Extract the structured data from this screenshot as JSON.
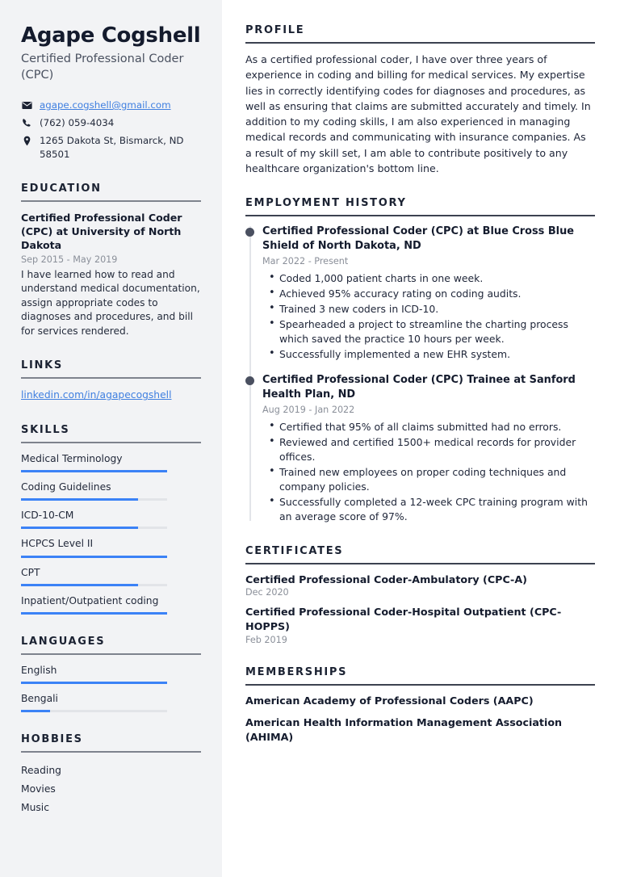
{
  "sidebar": {
    "name": "Agape Cogshell",
    "job_title": "Certified Professional Coder (CPC)",
    "contacts": [
      {
        "icon": "envelope-icon",
        "text": "agape.cogshell@gmail.com",
        "is_link": true
      },
      {
        "icon": "phone-icon",
        "text": "(762) 059-4034",
        "is_link": false
      },
      {
        "icon": "map-pin-icon",
        "text": "1265 Dakota St, Bismarck, ND 58501",
        "is_link": false
      }
    ],
    "education": {
      "heading": "EDUCATION",
      "items": [
        {
          "title": "Certified Professional Coder (CPC) at University of North Dakota",
          "date": "Sep 2015 - May 2019",
          "description": "I have learned how to read and understand medical documentation, assign appropriate codes to diagnoses and procedures, and bill for services rendered."
        }
      ]
    },
    "links": {
      "heading": "LINKS",
      "items": [
        {
          "label": "linkedin.com/in/agapecogshell"
        }
      ]
    },
    "skills": {
      "heading": "SKILLS",
      "items": [
        {
          "label": "Medical Terminology",
          "level": 100
        },
        {
          "label": "Coding Guidelines",
          "level": 80
        },
        {
          "label": "ICD-10-CM",
          "level": 80
        },
        {
          "label": "HCPCS Level II",
          "level": 100
        },
        {
          "label": "CPT",
          "level": 80
        },
        {
          "label": "Inpatient/Outpatient coding",
          "level": 100
        }
      ]
    },
    "languages": {
      "heading": "LANGUAGES",
      "items": [
        {
          "label": "English",
          "level": 100
        },
        {
          "label": "Bengali",
          "level": 20
        }
      ]
    },
    "hobbies": {
      "heading": "HOBBIES",
      "items": [
        {
          "label": "Reading"
        },
        {
          "label": "Movies"
        },
        {
          "label": "Music"
        }
      ]
    }
  },
  "main": {
    "profile": {
      "heading": "PROFILE",
      "text": "As a certified professional coder, I have over three years of experience in coding and billing for medical services. My expertise lies in correctly identifying codes for diagnoses and procedures, as well as ensuring that claims are submitted accurately and timely. In addition to my coding skills, I am also experienced in managing medical records and communicating with insurance companies. As a result of my skill set, I am able to contribute positively to any healthcare organization's bottom line."
    },
    "employment": {
      "heading": "EMPLOYMENT HISTORY",
      "jobs": [
        {
          "title": "Certified Professional Coder (CPC) at Blue Cross Blue Shield of North Dakota, ND",
          "date": "Mar 2022 - Present",
          "bullets": [
            "Coded 1,000 patient charts in one week.",
            "Achieved 95% accuracy rating on coding audits.",
            "Trained 3 new coders in ICD-10.",
            "Spearheaded a project to streamline the charting process which saved the practice 10 hours per week.",
            "Successfully implemented a new EHR system."
          ]
        },
        {
          "title": "Certified Professional Coder (CPC) Trainee at Sanford Health Plan, ND",
          "date": "Aug 2019 - Jan 2022",
          "bullets": [
            "Certified that 95% of all claims submitted had no errors.",
            "Reviewed and certified 1500+ medical records for provider offices.",
            "Trained new employees on proper coding techniques and company policies.",
            "Successfully completed a 12-week CPC training program with an average score of 97%."
          ]
        }
      ]
    },
    "certificates": {
      "heading": "CERTIFICATES",
      "items": [
        {
          "title": "Certified Professional Coder-Ambulatory (CPC-A)",
          "date": "Dec 2020"
        },
        {
          "title": "Certified Professional Coder-Hospital Outpatient (CPC-HOPPS)",
          "date": "Feb 2019"
        }
      ]
    },
    "memberships": {
      "heading": "MEMBERSHIPS",
      "items": [
        {
          "title": "American Academy of Professional Coders (AAPC)"
        },
        {
          "title": "American Health Information Management Association (AHIMA)"
        }
      ]
    }
  },
  "colors": {
    "accent_blue": "#3b82f6",
    "link_blue": "#3f7fe0",
    "heading_navy": "#1b2232",
    "sidebar_bg": "#f2f3f5",
    "muted_gray": "#8a8f99"
  }
}
